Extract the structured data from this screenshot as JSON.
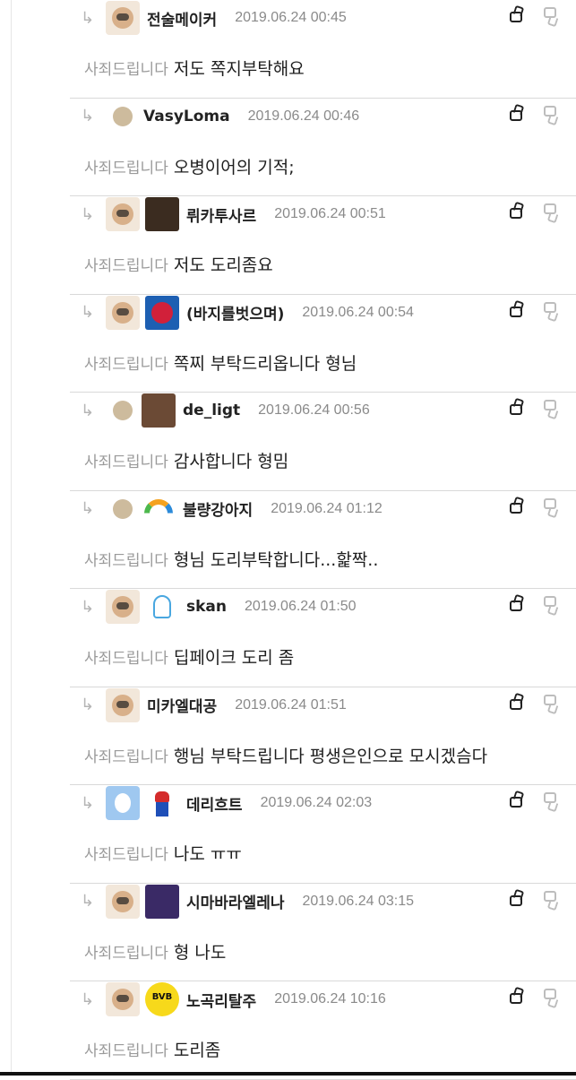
{
  "comments": [
    {
      "name": "전술메이커",
      "date": "2019.06.24 00:45",
      "to": "사죄드립니다",
      "text": "저도 쪽지부탁해요",
      "avatar": "dog",
      "badge": ""
    },
    {
      "name": "VasyLoma",
      "date": "2019.06.24 00:46",
      "to": "사죄드립니다",
      "text": "오병이어의 기적;",
      "avatar": "circle",
      "badge": ""
    },
    {
      "name": "뤼카투사르",
      "date": "2019.06.24 00:51",
      "to": "사죄드립니다",
      "text": "저도 도리좀요",
      "avatar": "dog",
      "badge": "dark"
    },
    {
      "name": "(바지를벗으며)",
      "date": "2019.06.24 00:54",
      "to": "사죄드립니다",
      "text": "쪽찌 부탁드리옵니다 형님",
      "avatar": "dog",
      "badge": "flag"
    },
    {
      "name": "de_ligt",
      "date": "2019.06.24 00:56",
      "to": "사죄드립니다",
      "text": "감사합니다 형밈",
      "avatar": "circle",
      "badge": "photo"
    },
    {
      "name": "불량강아지",
      "date": "2019.06.24 01:12",
      "to": "사죄드립니다",
      "text": "형님 도리부탁합니다...핥짝..",
      "avatar": "circle",
      "badge": "rainbow"
    },
    {
      "name": "skan",
      "date": "2019.06.24 01:50",
      "to": "사죄드립니다",
      "text": "딥페이크 도리 좀",
      "avatar": "dog",
      "badge": "ghost"
    },
    {
      "name": "미카엘대공",
      "date": "2019.06.24 01:51",
      "to": "사죄드립니다",
      "text": "행님 부탁드립니다 평생은인으로 모시겠슴다",
      "avatar": "dog",
      "badge": ""
    },
    {
      "name": "데리흐트",
      "date": "2019.06.24 02:03",
      "to": "사죄드립니다",
      "text": "나도 ㅠㅠ",
      "avatar": "blue",
      "badge": "mario"
    },
    {
      "name": "시마바라엘레나",
      "date": "2019.06.24 03:15",
      "to": "사죄드립니다",
      "text": "형 나도",
      "avatar": "dog",
      "badge": "purple"
    },
    {
      "name": "노곡리탈주",
      "date": "2019.06.24 10:16",
      "to": "사죄드립니다",
      "text": "도리좀",
      "avatar": "dog",
      "badge": "bvb",
      "badge_text": "BVB"
    }
  ],
  "icons": {
    "reply": "reply-arrow-icon",
    "like": "thumbs-up-icon",
    "dislike": "thumbs-down-icon"
  }
}
